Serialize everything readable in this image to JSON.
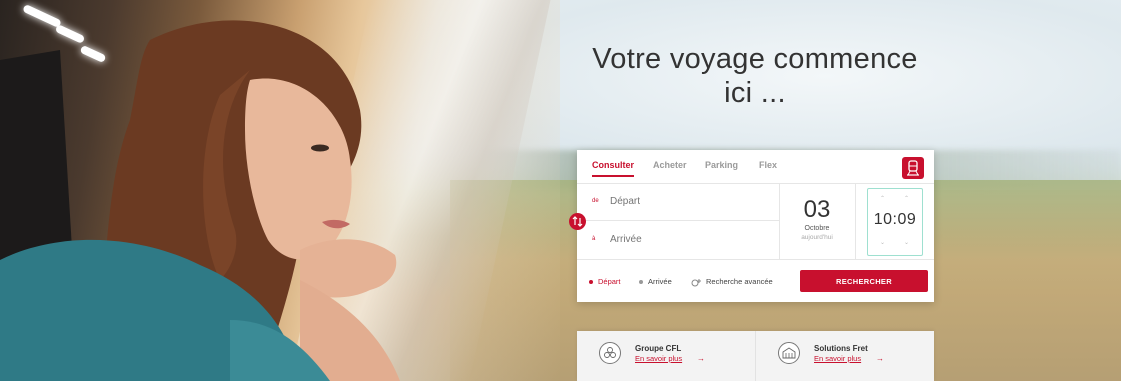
{
  "hero": {
    "title_line1": "Votre voyage commence",
    "title_line2": "ici ..."
  },
  "colors": {
    "brand": "#c8102e",
    "time_border": "#9ee0d0"
  },
  "tabs": [
    {
      "label": "Consulter",
      "active": true
    },
    {
      "label": "Acheter",
      "active": false
    },
    {
      "label": "Parking",
      "active": false
    },
    {
      "label": "Flex",
      "active": false
    }
  ],
  "search": {
    "from_prefix": "de",
    "from_placeholder": "Départ",
    "to_prefix": "à",
    "to_placeholder": "Arrivée",
    "date_day": "03",
    "date_month": "Octobre",
    "date_sub": "aujourd'hui",
    "time_hour": "10",
    "time_sep": ":",
    "time_min": "09",
    "opt_depart": "Départ",
    "opt_arrivee": "Arrivée",
    "opt_advanced": "Recherche avancée",
    "button": "RECHERCHER"
  },
  "footer": [
    {
      "title": "Groupe CFL",
      "link": "En savoir plus",
      "icon": "group-icon"
    },
    {
      "title": "Solutions Fret",
      "link": "En savoir plus",
      "icon": "freight-icon"
    }
  ]
}
